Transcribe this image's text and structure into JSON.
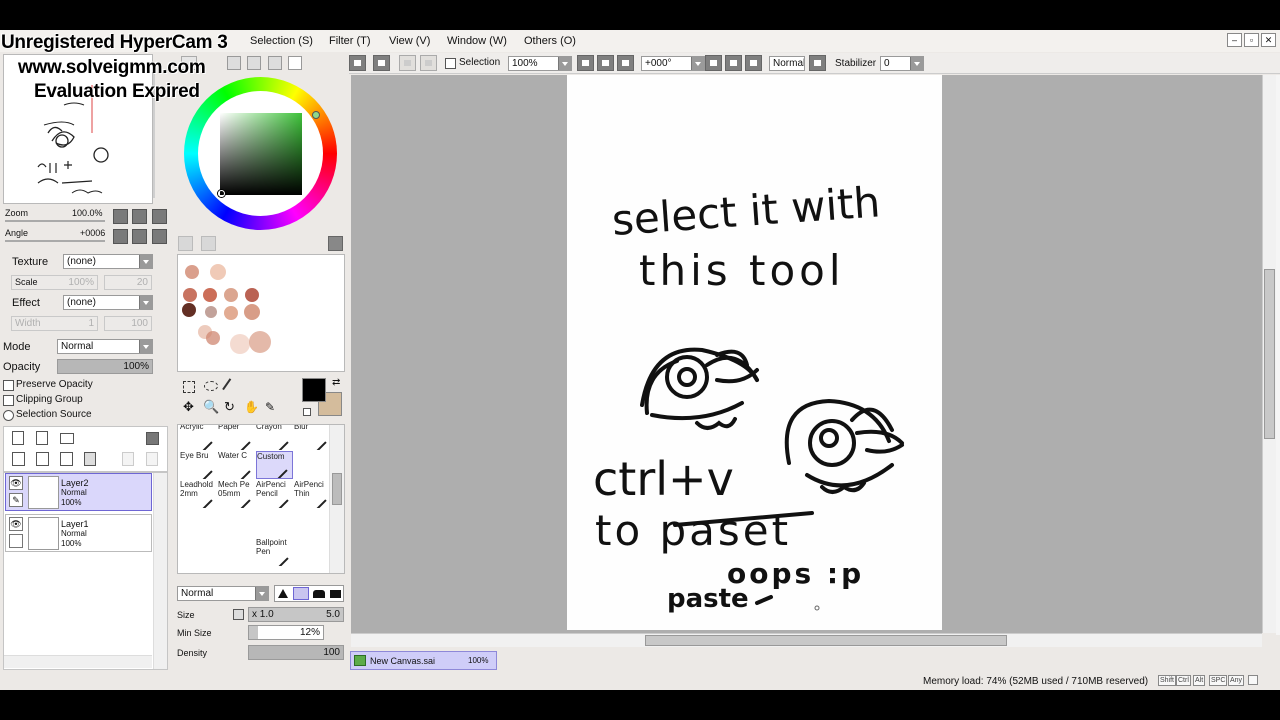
{
  "watermark": {
    "line1": "Unregistered HyperCam 3",
    "line2": "www.solveigmm.com",
    "line3": "Evaluation Expired"
  },
  "menu": [
    {
      "label": "Selection (S)"
    },
    {
      "label": "Filter (T)"
    },
    {
      "label": "View (V)"
    },
    {
      "label": "Window (W)"
    },
    {
      "label": "Others (O)"
    }
  ],
  "navigator": {
    "zoom_label": "Zoom",
    "zoom_value": "100.0%",
    "angle_label": "Angle",
    "angle_value": "+0006"
  },
  "texture": {
    "label": "Texture",
    "value": "(none)",
    "scale_label": "Scale",
    "scale_value": "100%",
    "scale_num": "20"
  },
  "effect": {
    "label": "Effect",
    "value": "(none)",
    "width_label": "Width",
    "width_value": "1",
    "width_num": "100"
  },
  "blend": {
    "mode_label": "Mode",
    "mode_value": "Normal",
    "opacity_label": "Opacity",
    "opacity_value": "100%"
  },
  "layer_options": {
    "preserve_opacity": "Preserve Opacity",
    "clipping_group": "Clipping Group",
    "selection_source": "Selection Source"
  },
  "layers": [
    {
      "name": "Layer2",
      "mode": "Normal",
      "opacity": "100%",
      "selected": true
    },
    {
      "name": "Layer1",
      "mode": "Normal",
      "opacity": "100%",
      "selected": false
    }
  ],
  "swatches": [
    {
      "color": "#d89a86"
    },
    {
      "color": "#efc7b3"
    },
    {
      "color": "#c56b57"
    },
    {
      "color": "#c9664f"
    },
    {
      "color": "#d9a089"
    },
    {
      "color": "#b65a4a"
    },
    {
      "color": "#5b2418"
    },
    {
      "color": "#bf9d95"
    },
    {
      "color": "#e0a68c"
    },
    {
      "color": "#d69881"
    },
    {
      "color": "#e7b9a7"
    },
    {
      "color": "#cf8771"
    },
    {
      "color": "#f0cfc1"
    },
    {
      "color": "#dba28c"
    }
  ],
  "colors": {
    "primary": "#000000",
    "secondary": "#d4bc9c"
  },
  "tools": [
    {
      "label": "Acrylic"
    },
    {
      "label": "Paper"
    },
    {
      "label": "Crayon"
    },
    {
      "label": "Blur"
    },
    {
      "label": "Eye Bru"
    },
    {
      "label": "Water C"
    },
    {
      "label": "Custom"
    },
    {
      "label": ""
    },
    {
      "label": "Leadhold 2mm"
    },
    {
      "label": "Mech Pe 05mm"
    },
    {
      "label": "AirPenci Pencil"
    },
    {
      "label": "AirPenci Thin"
    },
    {
      "label": ""
    },
    {
      "label": ""
    },
    {
      "label": ""
    },
    {
      "label": ""
    },
    {
      "label": ""
    },
    {
      "label": ""
    },
    {
      "label": "Ballpoint Pen"
    },
    {
      "label": ""
    }
  ],
  "brush": {
    "mode_value": "Normal",
    "size_label": "Size",
    "size_mult": "x 1.0",
    "size_value": "5.0",
    "min_size_label": "Min Size",
    "min_size_value": "12%",
    "density_label": "Density",
    "density_value": "100"
  },
  "toolbar": {
    "selection_label": "Selection",
    "zoom_value": "100%",
    "angle_value": "+000°",
    "blend_value": "Normal",
    "stabilizer_label": "Stabilizer",
    "stabilizer_value": "0"
  },
  "canvas": {
    "line1": "select it with",
    "line2": "this tool",
    "line3": "ctrl+v",
    "line4": "to paset",
    "line5": "oops :p",
    "line6": "paste"
  },
  "doc_tab": {
    "name": "New Canvas.sai",
    "zoom": "100%"
  },
  "status": {
    "memory": "Memory load: 74% (52MB used / 710MB reserved)",
    "keys": [
      "Shift",
      "Ctrl",
      "Alt",
      "SPC",
      "Any"
    ]
  }
}
